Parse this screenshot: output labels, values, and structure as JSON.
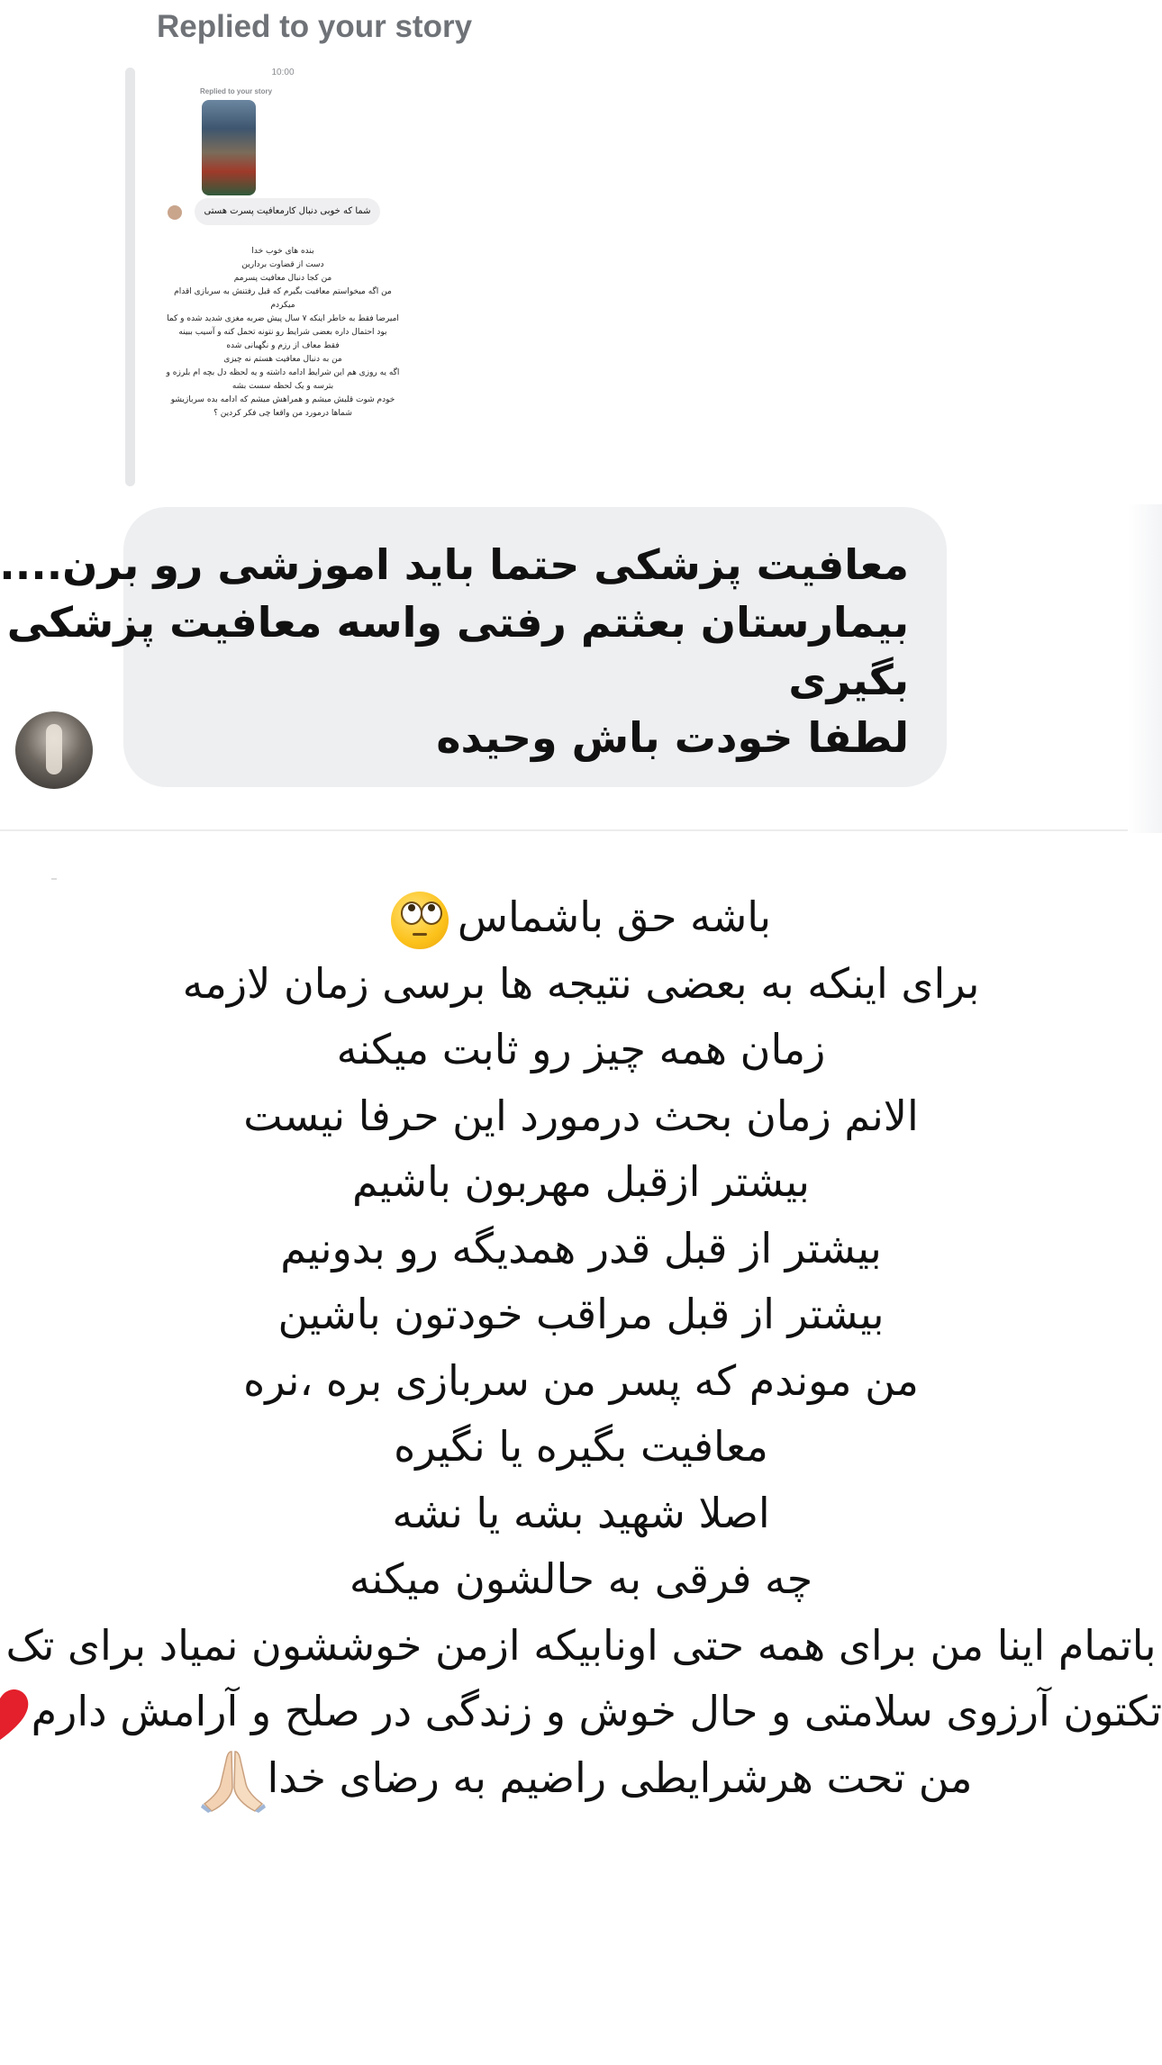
{
  "reply": {
    "header": "Replied to your story"
  },
  "story_preview": {
    "time": "10:00",
    "replied_label": "Replied to your story",
    "reply_bubble": "شما که خوبی دنبال کارمعافیت پسرت هستی",
    "text_lines": [
      "بنده های خوب خدا",
      "دست از قضاوت بردارین",
      "من کجا دنبال معافیت پسرمم",
      "من اگه میخواستم معافیت بگیرم که قبل رفتنش به سربازی اقدام",
      "میکردم",
      "امیرضا فقط به خاطر اینکه ۷ سال پیش ضربه مغزی شدید شده و کما",
      "بود احتمال داره بعضی شرایط رو نتونه تحمل کنه و آسیب ببینه",
      "فقط معاف از رزم و نگهبانی شده",
      "من به دنبال معافیت هستم نه چیزی",
      "اگه یه روزی هم این شرایط ادامه داشته و یه لحظه دل بچه ام بلرزه و",
      "بترسه و یک لحظه سست بشه",
      "خودم شوت قلبش میشم و همراهش میشم که ادامه بده سربازیشو",
      "شماها درمورد من واقعا چی فکر کردین ؟"
    ]
  },
  "message": {
    "lines": [
      "معافیت پزشکی حتما باید اموزشی رو برن....",
      "بیمارستان بعثتم رفتی واسه معافیت پزشکی",
      "بگیری",
      "لطفا خودت باش وحیده"
    ]
  },
  "post": {
    "lines": [
      "باشه حق باشماس",
      "برای اینکه به بعضی نتیجه ها برسی زمان لازمه",
      "زمان همه چیز رو ثابت میکنه",
      "الانم زمان بحث درمورد این حرفا نیست",
      "بیشتر ازقبل مهربون باشیم",
      "بیشتر از قبل قدر همدیگه رو بدونیم",
      "بیشتر از قبل مراقب خودتون باشین",
      "من موندم که پسر من سربازی بره ،نره",
      "معافیت بگیره یا نگیره",
      "اصلا شهید بشه یا نشه",
      "چه فرقی به حالشون میکنه",
      "باتمام اینا من برای همه حتی اونابیکه ازمن خوششون نمیاد برای تک",
      "تکتون آرزوی سلامتی و حال خوش و زندگی در صلح و آرامش دارم",
      "من تحت هرشرایطی راضیم به رضای خدا"
    ],
    "emojis": {
      "line1": "face-with-rolling-eyes-icon",
      "line13": "red-heart-icon",
      "line14": "folded-hands-icon"
    }
  }
}
